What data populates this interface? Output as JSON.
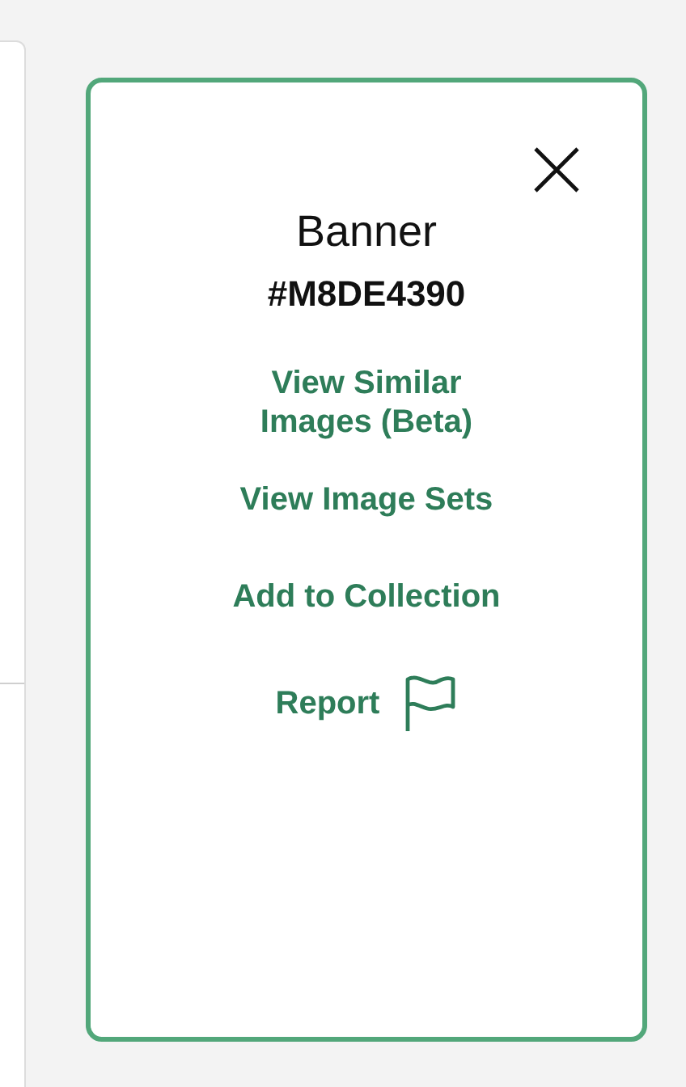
{
  "panel": {
    "title": "Banner",
    "id_code": "#M8DE4390",
    "links": [
      {
        "kind": "link",
        "label": "View Similar Images (Beta)"
      },
      {
        "kind": "link",
        "label": "View Image Sets"
      },
      {
        "kind": "link",
        "label": "Add to Collection"
      },
      {
        "kind": "flag",
        "label": "Report"
      }
    ]
  }
}
